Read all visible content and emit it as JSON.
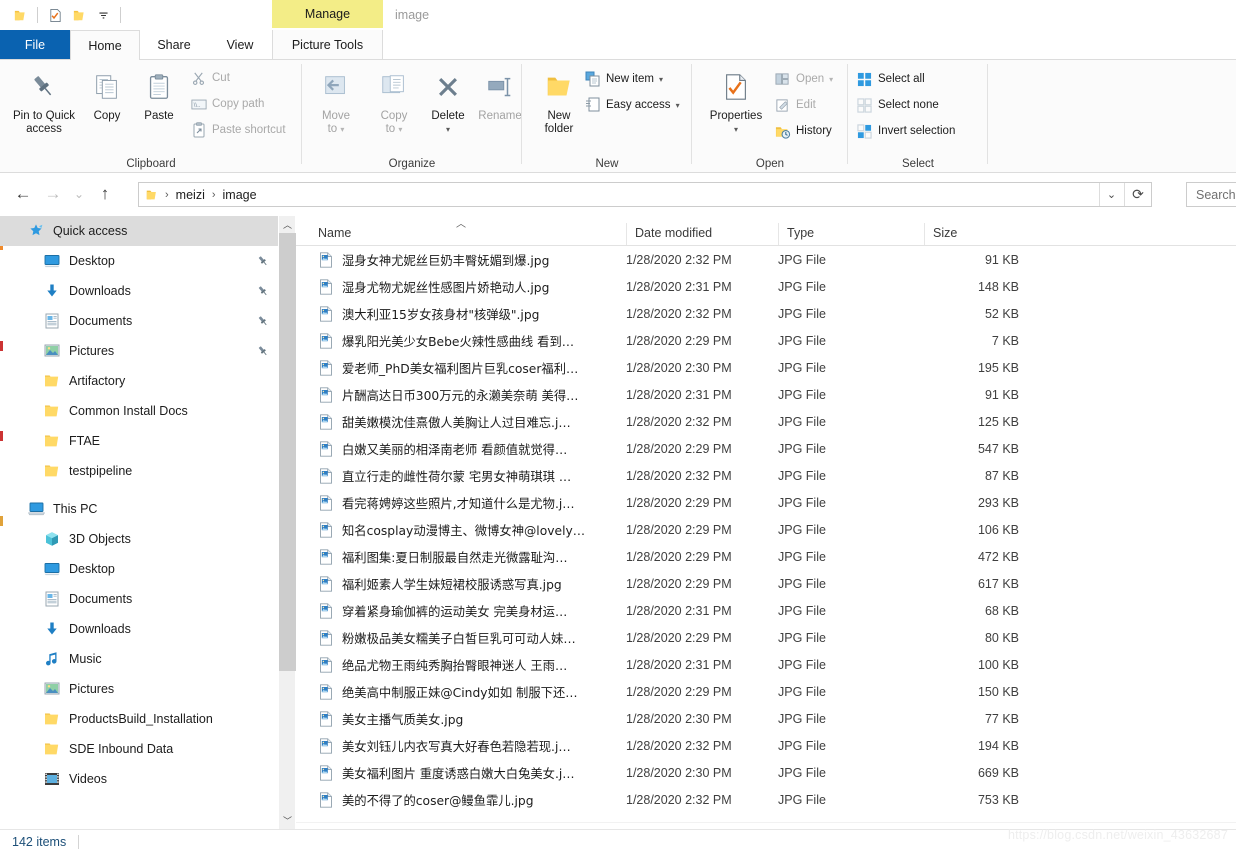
{
  "window": {
    "title": "image",
    "contextual_tab_group": "Picture Tools",
    "contextual_tab": "Manage"
  },
  "quick_access_toolbar": {
    "items": [
      {
        "name": "folder-icon",
        "label": ""
      },
      {
        "name": "properties-icon",
        "label": ""
      },
      {
        "name": "new-folder-icon",
        "label": ""
      },
      {
        "name": "customize-dropdown",
        "label": ""
      }
    ]
  },
  "ribbon": {
    "tabs": [
      {
        "id": "file",
        "label": "File"
      },
      {
        "id": "home",
        "label": "Home"
      },
      {
        "id": "share",
        "label": "Share"
      },
      {
        "id": "view",
        "label": "View"
      },
      {
        "id": "picture-tools",
        "label": "Picture Tools"
      }
    ],
    "active_tab": "Home",
    "groups": [
      {
        "id": "clipboard",
        "label": "Clipboard",
        "big_buttons": [
          {
            "label": "Pin to Quick\naccess",
            "line1": "Pin to Quick",
            "line2": "access",
            "icon": "pin-icon",
            "disabled": false
          },
          {
            "label": "Copy",
            "line1": "Copy",
            "line2": "",
            "icon": "copy-icon",
            "disabled": false
          },
          {
            "label": "Paste",
            "line1": "Paste",
            "line2": "",
            "icon": "paste-icon",
            "disabled": false
          }
        ],
        "small_buttons": [
          {
            "label": "Cut",
            "icon": "scissors-icon",
            "disabled": true
          },
          {
            "label": "Copy path",
            "icon": "copy-path-icon",
            "disabled": true
          },
          {
            "label": "Paste shortcut",
            "icon": "paste-shortcut-icon",
            "disabled": true
          }
        ]
      },
      {
        "id": "organize",
        "label": "Organize",
        "big_buttons": [
          {
            "line1": "Move",
            "line2": "to",
            "icon": "move-to-icon",
            "has_caret": true,
            "disabled": true
          },
          {
            "line1": "Copy",
            "line2": "to",
            "icon": "copy-to-icon",
            "has_caret": true,
            "disabled": true
          },
          {
            "line1": "Delete",
            "line2": "",
            "icon": "delete-x-icon",
            "has_caret": true,
            "disabled": false
          },
          {
            "line1": "Rename",
            "line2": "",
            "icon": "rename-icon",
            "has_caret": false,
            "disabled": true
          }
        ]
      },
      {
        "id": "new",
        "label": "New",
        "big_buttons": [
          {
            "line1": "New",
            "line2": "folder",
            "icon": "new-folder-icon",
            "has_caret": false,
            "disabled": false
          }
        ],
        "small_buttons": [
          {
            "label": "New item",
            "icon": "new-item-icon",
            "has_caret": true,
            "disabled": false
          },
          {
            "label": "Easy access",
            "icon": "easy-access-icon",
            "has_caret": true,
            "disabled": false
          }
        ]
      },
      {
        "id": "open",
        "label": "Open",
        "big_buttons": [
          {
            "line1": "Properties",
            "line2": "",
            "icon": "properties-icon",
            "has_caret": true,
            "disabled": false
          }
        ],
        "small_buttons": [
          {
            "label": "Open",
            "icon": "open-icon",
            "has_caret": true,
            "disabled": true
          },
          {
            "label": "Edit",
            "icon": "edit-icon",
            "has_caret": false,
            "disabled": true
          },
          {
            "label": "History",
            "icon": "history-icon",
            "has_caret": false,
            "disabled": false
          }
        ]
      },
      {
        "id": "select",
        "label": "Select",
        "small_buttons": [
          {
            "label": "Select all",
            "icon": "select-all-icon",
            "disabled": false
          },
          {
            "label": "Select none",
            "icon": "select-none-icon",
            "disabled": false
          },
          {
            "label": "Invert selection",
            "icon": "invert-selection-icon",
            "disabled": false
          }
        ]
      }
    ]
  },
  "navigation": {
    "back_label": "Back",
    "forward_label": "Forward",
    "recent_label": "Recent locations",
    "up_label": "Up",
    "breadcrumbs": [
      "meizi",
      "image"
    ],
    "address_dropdown": "chevron-down-icon",
    "refresh": "refresh-icon"
  },
  "search": {
    "placeholder": "Search",
    "visible_text": "Search"
  },
  "sidebar": {
    "items": [
      {
        "label": "Quick access",
        "icon": "quick-access-star-icon",
        "level": 0,
        "selected": true,
        "pinned": false
      },
      {
        "label": "Desktop",
        "icon": "desktop-icon",
        "level": 1,
        "selected": false,
        "pinned": true
      },
      {
        "label": "Downloads",
        "icon": "downloads-icon",
        "level": 1,
        "selected": false,
        "pinned": true
      },
      {
        "label": "Documents",
        "icon": "documents-icon",
        "level": 1,
        "selected": false,
        "pinned": true
      },
      {
        "label": "Pictures",
        "icon": "pictures-icon",
        "level": 1,
        "selected": false,
        "pinned": true
      },
      {
        "label": "Artifactory",
        "icon": "folder-icon",
        "level": 1,
        "selected": false,
        "pinned": false
      },
      {
        "label": "Common Install Docs",
        "icon": "folder-icon",
        "level": 1,
        "selected": false,
        "pinned": false
      },
      {
        "label": "FTAE",
        "icon": "folder-icon",
        "level": 1,
        "selected": false,
        "pinned": false
      },
      {
        "label": "testpipeline",
        "icon": "folder-icon",
        "level": 1,
        "selected": false,
        "pinned": false
      },
      {
        "label": "",
        "icon": "spacer",
        "level": 0,
        "selected": false,
        "pinned": false
      },
      {
        "label": "This PC",
        "icon": "this-pc-icon",
        "level": 0,
        "selected": false,
        "pinned": false
      },
      {
        "label": "3D Objects",
        "icon": "3d-objects-icon",
        "level": 1,
        "selected": false,
        "pinned": false
      },
      {
        "label": "Desktop",
        "icon": "desktop-icon",
        "level": 1,
        "selected": false,
        "pinned": false
      },
      {
        "label": "Documents",
        "icon": "documents-icon",
        "level": 1,
        "selected": false,
        "pinned": false
      },
      {
        "label": "Downloads",
        "icon": "downloads-icon",
        "level": 1,
        "selected": false,
        "pinned": false
      },
      {
        "label": "Music",
        "icon": "music-icon",
        "level": 1,
        "selected": false,
        "pinned": false
      },
      {
        "label": "Pictures",
        "icon": "pictures-icon",
        "level": 1,
        "selected": false,
        "pinned": false
      },
      {
        "label": "ProductsBuild_Installation",
        "icon": "folder-icon",
        "level": 1,
        "selected": false,
        "pinned": false
      },
      {
        "label": "SDE Inbound Data",
        "icon": "folder-icon",
        "level": 1,
        "selected": false,
        "pinned": false
      },
      {
        "label": "Videos",
        "icon": "videos-icon",
        "level": 1,
        "selected": false,
        "pinned": false
      }
    ]
  },
  "file_list": {
    "columns": [
      {
        "key": "name",
        "label": "Name",
        "sorted": true,
        "sort_dir": "asc"
      },
      {
        "key": "date",
        "label": "Date modified",
        "sorted": false
      },
      {
        "key": "type",
        "label": "Type",
        "sorted": false
      },
      {
        "key": "size",
        "label": "Size",
        "sorted": false
      }
    ],
    "rows": [
      {
        "name": "湿身女神尤妮丝巨奶丰臀妩媚到爆.jpg",
        "date": "1/28/2020 2:32 PM",
        "type": "JPG File",
        "size": "91 KB"
      },
      {
        "name": "湿身尤物尤妮丝性感图片娇艳动人.jpg",
        "date": "1/28/2020 2:31 PM",
        "type": "JPG File",
        "size": "148 KB"
      },
      {
        "name": "澳大利亚15岁女孩身材\"核弹级\".jpg",
        "date": "1/28/2020 2:32 PM",
        "type": "JPG File",
        "size": "52 KB"
      },
      {
        "name": "爆乳阳光美少女Bebe火辣性感曲线 看到…",
        "date": "1/28/2020 2:29 PM",
        "type": "JPG File",
        "size": "7 KB"
      },
      {
        "name": "爱老师_PhD美女福利图片巨乳coser福利…",
        "date": "1/28/2020 2:30 PM",
        "type": "JPG File",
        "size": "195 KB"
      },
      {
        "name": "片酬高达日币300万元的永濑美奈萌 美得…",
        "date": "1/28/2020 2:31 PM",
        "type": "JPG File",
        "size": "91 KB"
      },
      {
        "name": "甜美嫩模沈佳熹傲人美胸让人过目难忘.j…",
        "date": "1/28/2020 2:32 PM",
        "type": "JPG File",
        "size": "125 KB"
      },
      {
        "name": "白嫩又美丽的相泽南老师 看颜值就觉得…",
        "date": "1/28/2020 2:29 PM",
        "type": "JPG File",
        "size": "547 KB"
      },
      {
        "name": "直立行走的雌性荷尔蒙 宅男女神萌琪琪 …",
        "date": "1/28/2020 2:32 PM",
        "type": "JPG File",
        "size": "87 KB"
      },
      {
        "name": "看完蒋娉婷这些照片,才知道什么是尤物.j…",
        "date": "1/28/2020 2:29 PM",
        "type": "JPG File",
        "size": "293 KB"
      },
      {
        "name": "知名cosplay动漫博主、微博女神@lovely…",
        "date": "1/28/2020 2:29 PM",
        "type": "JPG File",
        "size": "106 KB"
      },
      {
        "name": "福利图集:夏日制服最自然走光微露耻沟…",
        "date": "1/28/2020 2:29 PM",
        "type": "JPG File",
        "size": "472 KB"
      },
      {
        "name": "福利姬素人学生妹短裙校服诱惑写真.jpg",
        "date": "1/28/2020 2:29 PM",
        "type": "JPG File",
        "size": "617 KB"
      },
      {
        "name": "穿着紧身瑜伽裤的运动美女 完美身材运…",
        "date": "1/28/2020 2:31 PM",
        "type": "JPG File",
        "size": "68 KB"
      },
      {
        "name": "粉嫩极品美女糯美子白皙巨乳可可动人妹…",
        "date": "1/28/2020 2:29 PM",
        "type": "JPG File",
        "size": "80 KB"
      },
      {
        "name": "绝品尤物王雨纯秀胸抬臀眼神迷人 王雨…",
        "date": "1/28/2020 2:31 PM",
        "type": "JPG File",
        "size": "100 KB"
      },
      {
        "name": "绝美高中制服正妹@Cindy如如 制服下还…",
        "date": "1/28/2020 2:29 PM",
        "type": "JPG File",
        "size": "150 KB"
      },
      {
        "name": "美女主播气质美女.jpg",
        "date": "1/28/2020 2:30 PM",
        "type": "JPG File",
        "size": "77 KB"
      },
      {
        "name": "美女刘钰儿内衣写真大好春色若隐若现.j…",
        "date": "1/28/2020 2:32 PM",
        "type": "JPG File",
        "size": "194 KB"
      },
      {
        "name": "美女福利图片 重度诱惑白嫩大白兔美女.j…",
        "date": "1/28/2020 2:30 PM",
        "type": "JPG File",
        "size": "669 KB"
      },
      {
        "name": "美的不得了的coser@鳗鱼霏儿.jpg",
        "date": "1/28/2020 2:32 PM",
        "type": "JPG File",
        "size": "753 KB"
      }
    ]
  },
  "status_bar": {
    "item_count": "142 items"
  },
  "watermark": {
    "text": "https://blog.csdn.net/weixin_43632687"
  },
  "colors": {
    "file_tab_blue": "#0a62b0",
    "contextual_yellow": "#f3ed87",
    "selection_gray": "#dcdcdc",
    "status_text_blue": "#1c4f78",
    "folder_yellow": "#ffd966"
  }
}
